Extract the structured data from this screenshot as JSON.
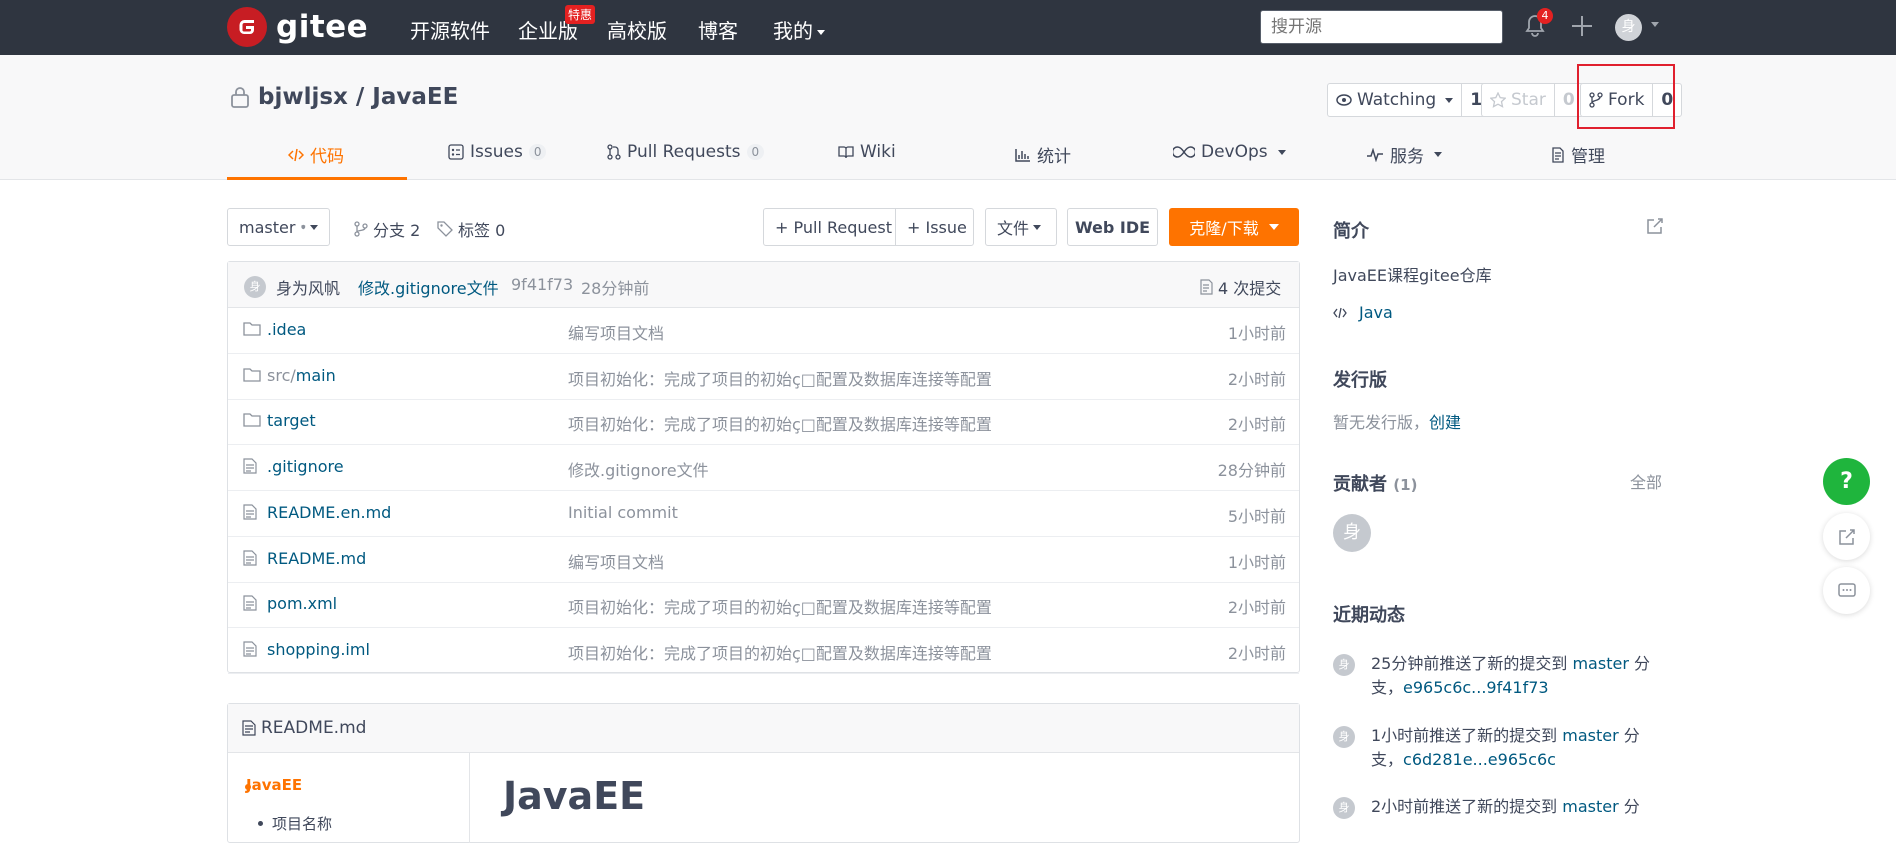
{
  "nav": {
    "logo_text": "gitee",
    "links": [
      "开源软件",
      "企业版",
      "高校版",
      "博客",
      "我的"
    ],
    "hot_badge": "特惠",
    "search_placeholder": "搜开源",
    "notification_count": "4",
    "avatar_char": "身"
  },
  "repo": {
    "title": "bjwljsx / JavaEE",
    "watch_label": "Watching",
    "watch_count": "1",
    "star_label": "Star",
    "star_count": "0",
    "fork_label": "Fork",
    "fork_count": "0"
  },
  "tabs": [
    {
      "label": "代码",
      "count": ""
    },
    {
      "label": "Issues",
      "count": "0"
    },
    {
      "label": "Pull Requests",
      "count": "0"
    },
    {
      "label": "Wiki",
      "count": ""
    },
    {
      "label": "统计",
      "count": ""
    },
    {
      "label": "DevOps",
      "count": ""
    },
    {
      "label": "服务",
      "count": ""
    },
    {
      "label": "管理",
      "count": ""
    }
  ],
  "toolbar": {
    "branch": "master",
    "branches": "分支 2",
    "tags": "标签 0",
    "pull_request": "+ Pull Request",
    "issue": "+ Issue",
    "file": "文件",
    "web_ide": "Web IDE",
    "clone": "克隆/下载"
  },
  "commit": {
    "avatar": "身",
    "author": "身为风帆",
    "message": "修改.gitignore文件",
    "sha": "9f41f73",
    "time": "28分钟前",
    "count": "4 次提交"
  },
  "files": [
    {
      "type": "folder",
      "name": ".idea",
      "name_prefix": "",
      "message": "编写项目文档",
      "time": "1小时前"
    },
    {
      "type": "folder",
      "name": "main",
      "name_prefix": "src/",
      "message": "项目初始化：完成了项目的初始ç□配置及数据库连接等配置",
      "time": "2小时前"
    },
    {
      "type": "folder",
      "name": "target",
      "name_prefix": "",
      "message": "项目初始化：完成了项目的初始ç□配置及数据库连接等配置",
      "time": "2小时前"
    },
    {
      "type": "file",
      "name": ".gitignore",
      "name_prefix": "",
      "message": "修改.gitignore文件",
      "time": "28分钟前"
    },
    {
      "type": "file",
      "name": "README.en.md",
      "name_prefix": "",
      "message": "Initial commit",
      "time": "5小时前"
    },
    {
      "type": "file",
      "name": "README.md",
      "name_prefix": "",
      "message": "编写项目文档",
      "time": "1小时前"
    },
    {
      "type": "file",
      "name": "pom.xml",
      "name_prefix": "",
      "message": "项目初始化：完成了项目的初始ç□配置及数据库连接等配置",
      "time": "2小时前"
    },
    {
      "type": "file",
      "name": "shopping.iml",
      "name_prefix": "",
      "message": "项目初始化：完成了项目的初始ç□配置及数据库连接等配置",
      "time": "2小时前"
    }
  ],
  "readme": {
    "filename": "README.md",
    "toc": [
      "JavaEE",
      "项目名称"
    ],
    "heading": "JavaEE"
  },
  "sidebar": {
    "intro_title": "简介",
    "intro_desc": "JavaEE课程gitee仓库",
    "language": "Java",
    "release_title": "发行版",
    "release_text": "暂无发行版，",
    "release_link": "创建",
    "contrib_title": "贡献者",
    "contrib_count": "(1)",
    "contrib_all": "全部",
    "contrib_avatar": "身",
    "activity_title": "近期动态",
    "activities": [
      {
        "avatar": "身",
        "text": "25分钟前推送了新的提交到",
        "branch": "master",
        "suffix": "分",
        "line2_pre": "支，",
        "range": "e965c6c...9f41f73"
      },
      {
        "avatar": "身",
        "text": "1小时前推送了新的提交到",
        "branch": "master",
        "suffix": "分",
        "line2_pre": "支，",
        "range": "c6d281e...e965c6c"
      },
      {
        "avatar": "身",
        "text": "2小时前推送了新的提交到",
        "branch": "master",
        "suffix": "分",
        "line2_pre": "",
        "range": ""
      }
    ]
  },
  "colors": {
    "brand": "#c71d23",
    "accent": "#fe7300",
    "link": "#005980",
    "help": "#1fb53d"
  }
}
